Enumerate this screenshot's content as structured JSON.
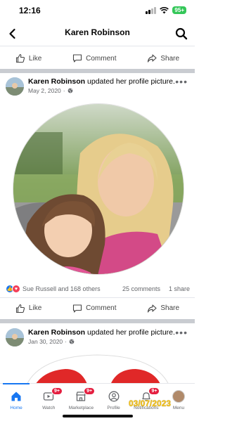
{
  "status_bar": {
    "time": "12:16",
    "battery": "95+"
  },
  "header": {
    "title": "Karen Robinson"
  },
  "actions": {
    "like": "Like",
    "comment": "Comment",
    "share": "Share"
  },
  "post1": {
    "author": "Karen Robinson",
    "action": " updated her profile picture.",
    "date": "May 2, 2020",
    "dot": "·",
    "reactions_text": "Sue Russell and 168 others",
    "comments": "25 comments",
    "shares": "1 share"
  },
  "post2": {
    "author": "Karen Robinson",
    "action": " updated her profile picture.",
    "date": "Jan 30, 2020",
    "dot": "·"
  },
  "bottom_nav": {
    "home": "Home",
    "watch": "Watch",
    "watch_badge": "9+",
    "marketplace": "Marketplace",
    "marketplace_badge": "9+",
    "profile": "Profile",
    "notifications": "Notifications",
    "notifications_badge": "9+",
    "menu": "Menu"
  },
  "watermark": "03/07/2023",
  "colors": {
    "accent": "#1877f2",
    "badge": "#e41e3f",
    "separator": "#c9ccd1",
    "watermark": "#f3c019"
  }
}
